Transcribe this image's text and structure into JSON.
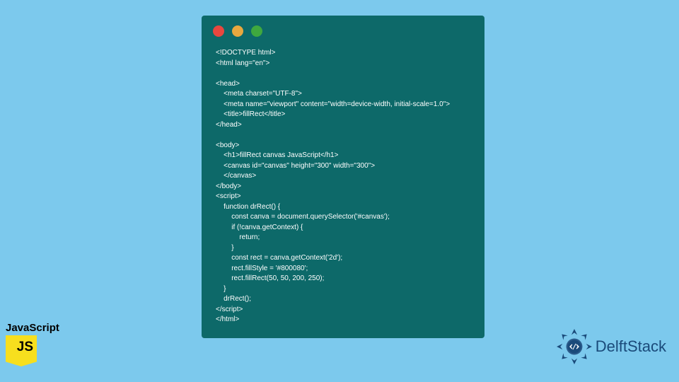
{
  "window": {
    "controls": [
      "close",
      "minimize",
      "maximize"
    ]
  },
  "code": "<!DOCTYPE html>\n<html lang=\"en\">\n\n<head>\n    <meta charset=\"UTF-8\">\n    <meta name=\"viewport\" content=\"width=device-width, initial-scale=1.0\">\n    <title>fillRect</title>\n</head>\n\n<body>\n    <h1>fillRect canvas JavaScript</h1>\n    <canvas id=\"canvas\" height=\"300\" width=\"300\">\n    </canvas>\n</body>\n<script>\n    function drRect() {\n        const canva = document.querySelector('#canvas');\n        if (!canva.getContext) {\n            return;\n        }\n        const rect = canva.getContext('2d');\n        rect.fillStyle = '#800080';\n        rect.fillRect(50, 50, 200, 250);\n    }\n    drRect();\n</script>\n</html>",
  "js_badge": {
    "label": "JavaScript",
    "icon_text": "JS"
  },
  "brand": {
    "name": "DelftStack"
  }
}
